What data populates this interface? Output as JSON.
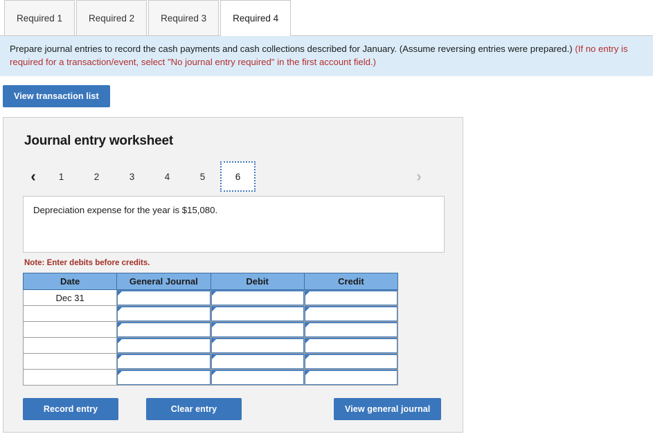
{
  "tabs": [
    {
      "label": "Required 1",
      "active": false
    },
    {
      "label": "Required 2",
      "active": false
    },
    {
      "label": "Required 3",
      "active": false
    },
    {
      "label": "Required 4",
      "active": true
    }
  ],
  "banner": {
    "main_text": "Prepare journal entries to record the cash payments and cash collections described for January. (Assume reversing entries were prepared.)",
    "red_text": "(If no entry is required for a transaction/event, select \"No journal entry required\" in the first account field.)"
  },
  "toolbar": {
    "view_transaction_list_label": "View transaction list"
  },
  "worksheet": {
    "title": "Journal entry worksheet",
    "pager": {
      "prev_icon": "chevron-left-icon",
      "prev_glyph": "‹",
      "next_icon": "chevron-right-icon",
      "next_glyph": "›",
      "pages": [
        "1",
        "2",
        "3",
        "4",
        "5",
        "6"
      ],
      "active_page": "6"
    },
    "description": "Depreciation expense for the year is $15,080.",
    "note": "Note: Enter debits before credits.",
    "table": {
      "headers": [
        "Date",
        "General Journal",
        "Debit",
        "Credit"
      ],
      "rows": [
        {
          "date": "Dec 31",
          "general_journal": "",
          "debit": "",
          "credit": ""
        },
        {
          "date": "",
          "general_journal": "",
          "debit": "",
          "credit": ""
        },
        {
          "date": "",
          "general_journal": "",
          "debit": "",
          "credit": ""
        },
        {
          "date": "",
          "general_journal": "",
          "debit": "",
          "credit": ""
        },
        {
          "date": "",
          "general_journal": "",
          "debit": "",
          "credit": ""
        },
        {
          "date": "",
          "general_journal": "",
          "debit": "",
          "credit": ""
        }
      ]
    },
    "buttons": {
      "record_entry": "Record entry",
      "clear_entry": "Clear entry",
      "view_general_journal": "View general journal"
    }
  },
  "colors": {
    "accent_blue": "#3a76bc",
    "table_header_blue": "#7cb0e4",
    "banner_bg": "#dbecf8",
    "panel_bg": "#f2f2f2",
    "note_red": "#a33028"
  }
}
